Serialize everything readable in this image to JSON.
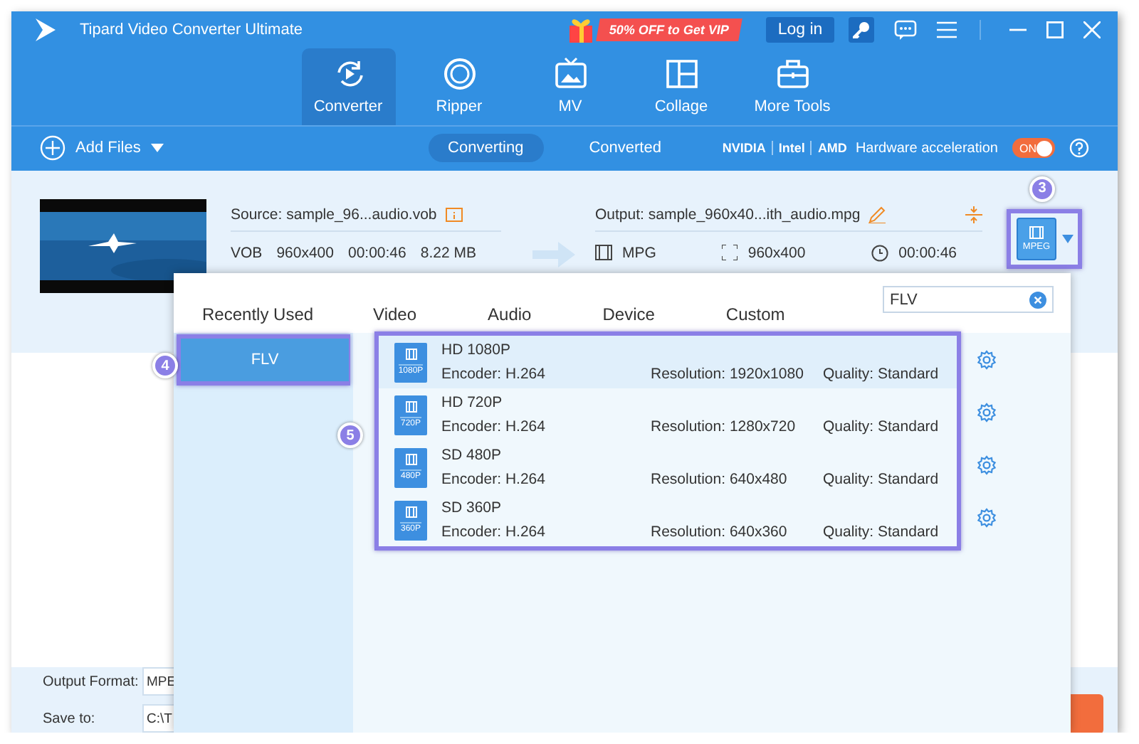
{
  "window": {
    "title": "Tipard Video Converter Ultimate"
  },
  "promo": "50% OFF to Get VIP",
  "login_button": "Log in",
  "nav_tabs": [
    {
      "label": "Converter",
      "kind": "converter",
      "selected": true
    },
    {
      "label": "Ripper",
      "kind": "ripper",
      "selected": false
    },
    {
      "label": "MV",
      "kind": "mv",
      "selected": false
    },
    {
      "label": "Collage",
      "kind": "collage",
      "selected": false
    },
    {
      "label": "More Tools",
      "kind": "tools",
      "selected": false
    }
  ],
  "toolbar": {
    "add_files": "Add Files",
    "views": [
      {
        "label": "Converting",
        "selected": true
      },
      {
        "label": "Converted",
        "selected": false
      }
    ],
    "vendors": [
      "NVIDIA",
      "Intel",
      "AMD"
    ],
    "hardware_label": "Hardware acceleration",
    "hardware_toggle": {
      "label": "ON",
      "on": true
    }
  },
  "file": {
    "source": "Source: sample_96...audio.vob",
    "format": "VOB",
    "resolution": "960x400",
    "duration": "00:00:46",
    "size": "8.22 MB",
    "output": "Output: sample_960x40...ith_audio.mpg",
    "output_format": "MPG",
    "output_resolution": "960x400",
    "output_duration": "00:00:46",
    "format_button": {
      "label": "MPEG",
      "callout": "3"
    }
  },
  "bottom": {
    "output_format_label": "Output Format:",
    "output_format_value": "MPE",
    "save_to_label": "Save to:",
    "save_to_value": "C:\\T"
  },
  "format_popup": {
    "tabs": [
      {
        "label": "Recently Used",
        "selected": false
      },
      {
        "label": "Video",
        "selected": false
      },
      {
        "label": "Audio",
        "selected": false
      },
      {
        "label": "Device",
        "selected": false
      },
      {
        "label": "Custom",
        "selected": false
      }
    ],
    "search": {
      "value": "FLV"
    },
    "categories": [
      {
        "label": "FLV",
        "selected": true,
        "callout": "4"
      }
    ],
    "presets_callout": "5",
    "presets": [
      {
        "name": "HD 1080P",
        "badge": "1080P",
        "encoder": "Encoder: H.264",
        "resolution": "Resolution: 1920x1080",
        "quality": "Quality: Standard",
        "selected": true
      },
      {
        "name": "HD 720P",
        "badge": "720P",
        "encoder": "Encoder: H.264",
        "resolution": "Resolution: 1280x720",
        "quality": "Quality: Standard",
        "selected": false
      },
      {
        "name": "SD 480P",
        "badge": "480P",
        "encoder": "Encoder: H.264",
        "resolution": "Resolution: 640x480",
        "quality": "Quality: Standard",
        "selected": false
      },
      {
        "name": "SD 360P",
        "badge": "360P",
        "encoder": "Encoder: H.264",
        "resolution": "Resolution: 640x360",
        "quality": "Quality: Standard",
        "selected": false
      }
    ]
  }
}
